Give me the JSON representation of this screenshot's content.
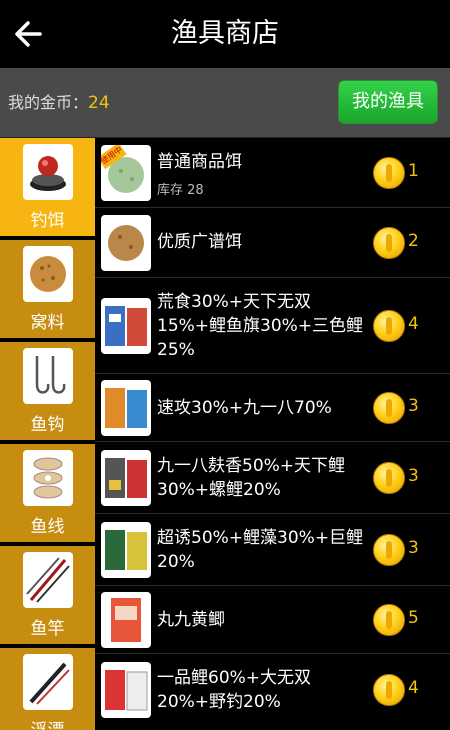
{
  "header": {
    "title": "渔具商店"
  },
  "coins": {
    "label": "我的金币：",
    "amount": "24"
  },
  "buttons": {
    "my_gear": "我的渔具"
  },
  "categories": [
    {
      "label": "钓饵",
      "icon": "bait-icon",
      "active": true
    },
    {
      "label": "窝料",
      "icon": "groundbait-icon",
      "active": false
    },
    {
      "label": "鱼钩",
      "icon": "hook-icon",
      "active": false
    },
    {
      "label": "鱼线",
      "icon": "line-spool-icon",
      "active": false
    },
    {
      "label": "鱼竿",
      "icon": "rod-icon",
      "active": false
    },
    {
      "label": "浮漂",
      "icon": "float-icon",
      "active": false
    }
  ],
  "items": [
    {
      "name": "普通商品饵",
      "stock": "库存 28",
      "price": "1",
      "tag": "使用中",
      "icon": "plain-bait-icon"
    },
    {
      "name": "优质广谱饵",
      "stock": "",
      "price": "2",
      "icon": "premium-bait-icon"
    },
    {
      "name": "荒食30%+天下无双15%+鲤鱼旗30%+三色鲤25%",
      "stock": "",
      "price": "4",
      "icon": "bait-pack-icon"
    },
    {
      "name": "速攻30%+九一八70%",
      "stock": "",
      "price": "3",
      "icon": "bait-pack-icon"
    },
    {
      "name": "九一八麸香50%+天下鲤30%+螺鲤20%",
      "stock": "",
      "price": "3",
      "icon": "bait-pack-icon"
    },
    {
      "name": "超诱50%+鲤藻30%+巨鲤20%",
      "stock": "",
      "price": "3",
      "icon": "bait-pack-icon"
    },
    {
      "name": "丸九黄鲫",
      "stock": "",
      "price": "5",
      "icon": "bait-pack-icon"
    },
    {
      "name": "一品鲤60%+大无双20%+野钓20%",
      "stock": "",
      "price": "4",
      "icon": "bait-pack-icon"
    }
  ]
}
